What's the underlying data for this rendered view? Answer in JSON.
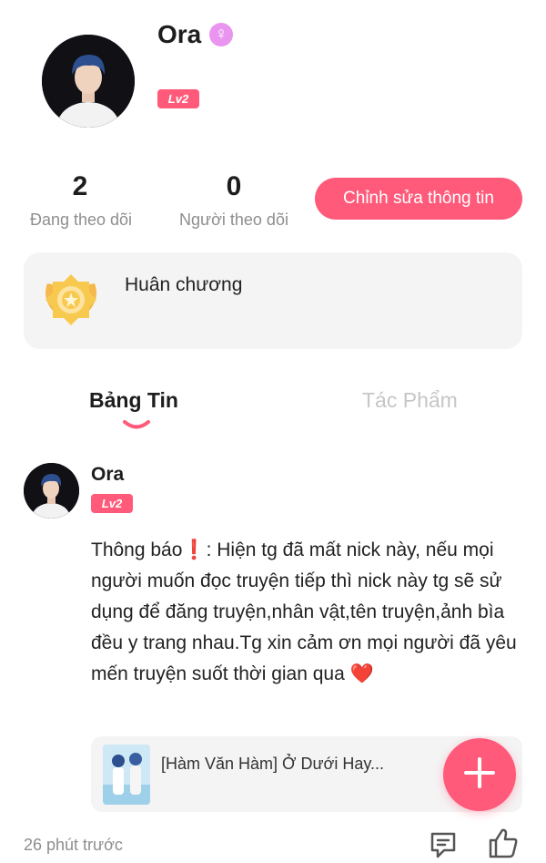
{
  "profile": {
    "name": "Ora",
    "gender_symbol": "♀",
    "level": "Lv2"
  },
  "stats": {
    "following_count": "2",
    "following_label": "Đang theo dõi",
    "followers_count": "0",
    "followers_label": "Người theo dõi"
  },
  "edit_button": "Chỉnh sửa thông tin",
  "medal": {
    "label": "Huân chương",
    "icon": "medal-icon"
  },
  "tabs": [
    {
      "label": "Bảng Tin",
      "active": true
    },
    {
      "label": "Tác Phẩm",
      "active": false
    }
  ],
  "post": {
    "author": "Ora",
    "level": "Lv2",
    "text": "Thông báo❗: Hiện tg đã mất nick này, nếu mọi người muốn đọc truyện tiếp thì nick này tg sẽ sử dụng để đăng truyện,nhân vật,tên truyện,ảnh bìa đều y trang nhau.Tg xin cảm ơn mọi người đã yêu mến truyện suốt thời gian qua ❤️",
    "linked_title": "[Hàm Văn Hàm] Ở Dưới Hay...",
    "time": "26 phút trước"
  },
  "colors": {
    "accent": "#ff5a7a",
    "card_bg": "#f4f4f4",
    "muted_text": "#8e8e8e",
    "gender_badge": "#e995f0"
  }
}
